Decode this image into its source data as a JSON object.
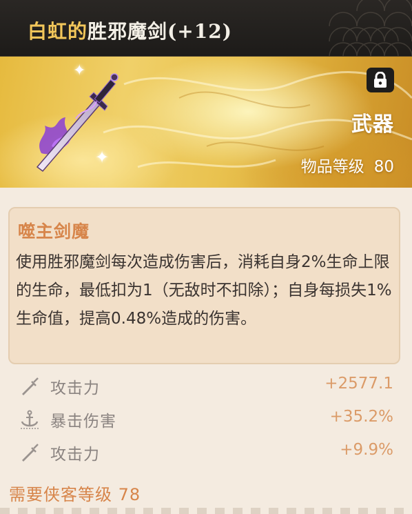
{
  "header": {
    "title_prefix": "白虹的",
    "title_main": "胜邪魔剑(+12)"
  },
  "banner": {
    "category": "武器",
    "item_level_label": "物品等级",
    "item_level_value": "80",
    "lock_icon": "lock-icon"
  },
  "skill": {
    "name": "噬主剑魔",
    "description": "使用胜邪魔剑每次造成伤害后，消耗自身2%生命上限的生命，最低扣为1（无敌时不扣除）；自身每损失1%生命值，提高0.48%造成的伤害。"
  },
  "stats": [
    {
      "icon": "sword-icon",
      "name": "攻击力",
      "value": "+2577.1"
    },
    {
      "icon": "anchor-icon",
      "name": "暴击伤害",
      "value": "+35.2%"
    },
    {
      "icon": "sword-icon",
      "name": "攻击力",
      "value": "+9.9%"
    }
  ],
  "requirement": "需要侠客等级 78",
  "colors": {
    "title_gold": "#f2c65a",
    "accent_orange": "#d7854a",
    "stat_value": "#db9b68"
  }
}
